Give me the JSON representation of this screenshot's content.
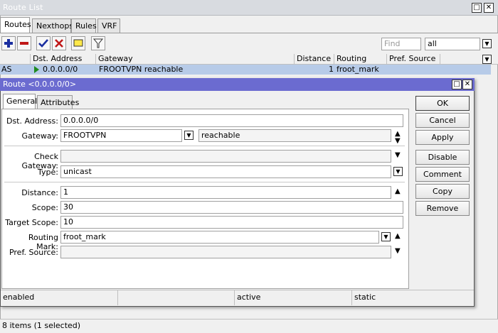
{
  "window": {
    "title": "Route List"
  },
  "tabs": [
    "Routes",
    "Nexthops",
    "Rules",
    "VRF"
  ],
  "toolbar": {
    "find_placeholder": "Find",
    "filter_value": "all"
  },
  "table": {
    "columns": [
      "Dst. Address",
      "Gateway",
      "Distance",
      "Routing Mark",
      "Pref. Source"
    ],
    "rows": [
      {
        "flags": "AS",
        "dst": "0.0.0.0/0",
        "gateway": "FROOTVPN reachable",
        "distance": "1",
        "routing_mark": "froot_mark",
        "pref_source": ""
      }
    ]
  },
  "status": {
    "items_text": "8 items (1 selected)"
  },
  "dialog": {
    "title": "Route <0.0.0.0/0>",
    "tabs": [
      "General",
      "Attributes"
    ],
    "fields": {
      "dst_address": {
        "label": "Dst. Address:",
        "value": "0.0.0.0/0"
      },
      "gateway": {
        "label": "Gateway:",
        "value": "FROOTVPN",
        "state": "reachable"
      },
      "check_gateway": {
        "label": "Check Gateway:",
        "value": ""
      },
      "type": {
        "label": "Type:",
        "value": "unicast"
      },
      "distance": {
        "label": "Distance:",
        "value": "1"
      },
      "scope": {
        "label": "Scope:",
        "value": "30"
      },
      "target_scope": {
        "label": "Target Scope:",
        "value": "10"
      },
      "routing_mark": {
        "label": "Routing Mark:",
        "value": "froot_mark"
      },
      "pref_source": {
        "label": "Pref. Source:",
        "value": ""
      }
    },
    "buttons": [
      "OK",
      "Cancel",
      "Apply",
      "Disable",
      "Comment",
      "Copy",
      "Remove"
    ],
    "status": [
      "enabled",
      "",
      "active",
      "static"
    ]
  },
  "colors": {
    "dialog_title_bg": "#6b6bd0",
    "selected_row_bg": "#b7cbe8"
  }
}
